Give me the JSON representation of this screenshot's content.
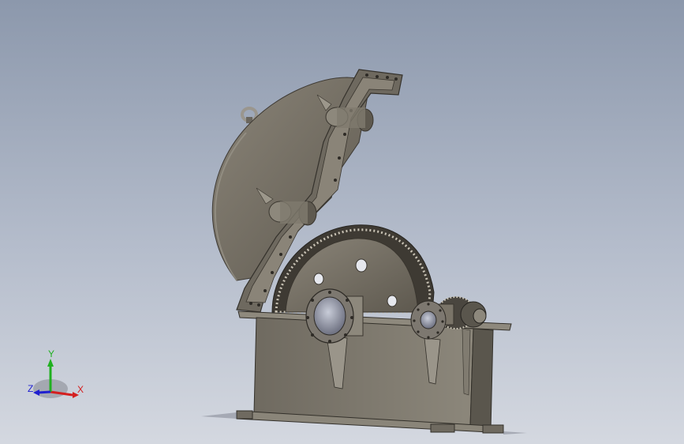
{
  "triad": {
    "x_label": "X",
    "y_label": "Y",
    "z_label": "Z",
    "x_color": "#d42020",
    "y_color": "#20b020",
    "z_color": "#2020d0"
  },
  "colors": {
    "background_top": "#8c98ac",
    "background_bottom": "#d4d8e0",
    "metal": "#7a7468",
    "metal_dark": "#4e4a42",
    "metal_light": "#a8a296"
  }
}
